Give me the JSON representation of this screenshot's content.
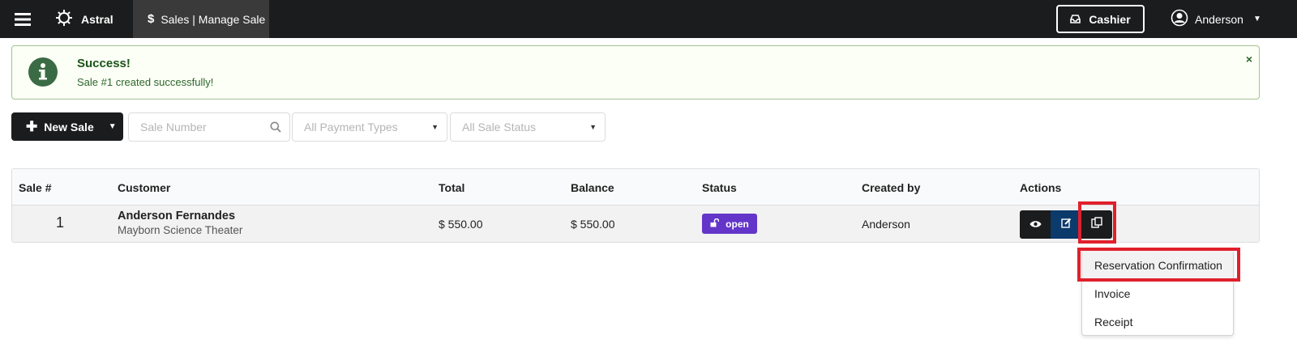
{
  "topbar": {
    "brand": "Astral",
    "active_tab": "Sales | Manage Sale",
    "cashier_label": "Cashier",
    "user_name": "Anderson"
  },
  "alert": {
    "title": "Success!",
    "message": "Sale #1 created successfully!",
    "close": "×"
  },
  "filters": {
    "new_sale_label": "New Sale",
    "sale_number_placeholder": "Sale Number",
    "payment_type": "All Payment Types",
    "sale_status": "All Sale Status"
  },
  "table": {
    "headers": [
      "Sale #",
      "Customer",
      "Total",
      "Balance",
      "Status",
      "Created by",
      "Actions"
    ],
    "rows": [
      {
        "number": "1",
        "customer_name": "Anderson Fernandes",
        "customer_org": "Mayborn Science Theater",
        "total": "$ 550.00",
        "balance": "$ 550.00",
        "status": "open",
        "created_by": "Anderson"
      }
    ]
  },
  "dropdown": {
    "items": [
      "Reservation Confirmation",
      "Invoice",
      "Receipt"
    ]
  },
  "colors": {
    "topbar": "#1b1c1d",
    "status_open": "#6435c9",
    "edit_button": "#0b3a6b",
    "highlight": "#e0202c"
  }
}
